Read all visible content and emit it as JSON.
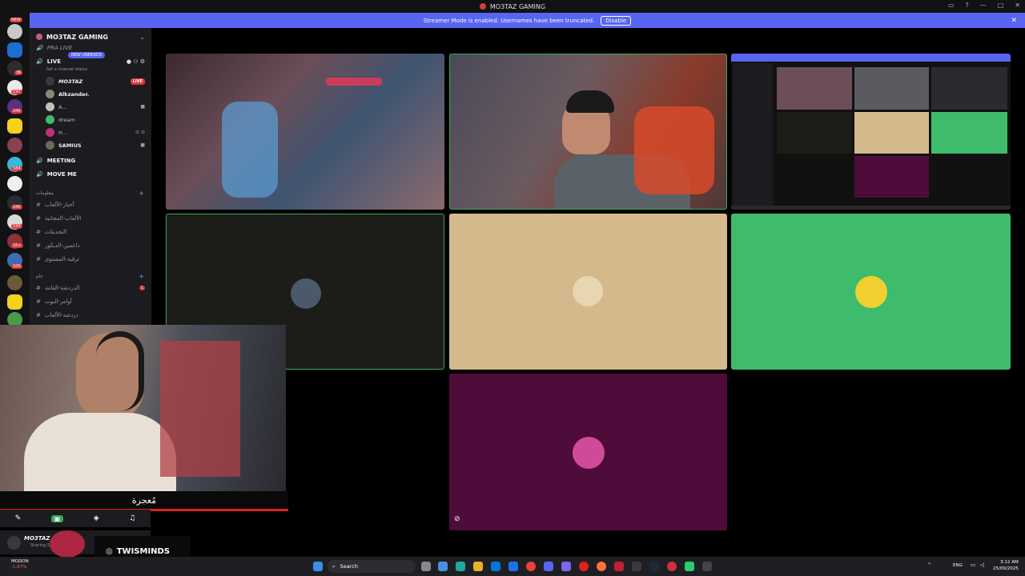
{
  "window": {
    "title": "MO3TAZ GAMING"
  },
  "banner": {
    "text": "Streamer Mode is enabled. Usernames have been truncated.",
    "button": "Disable"
  },
  "server_list": {
    "new_label": "NEW",
    "badges": [
      "36",
      "197",
      "240",
      "584",
      "240",
      "190",
      "1K+",
      "100"
    ]
  },
  "sidebar": {
    "server_name": "MO3TAZ GAMING",
    "pra_live": "PRA LIVE",
    "new_unreads": "NEW UNREADS",
    "live_channel": "LIVE",
    "status_placeholder": "Set a channel status",
    "voice_users": [
      {
        "name": "MO3TAZ",
        "live": "LIVE"
      },
      {
        "name": "Alkzander."
      },
      {
        "name": "A..."
      },
      {
        "name": "dream"
      },
      {
        "name": "H..."
      },
      {
        "name": "SAMIUS"
      }
    ],
    "channels": [
      "MEETING",
      "MOVE ME"
    ],
    "category_1": "معلومات",
    "category_1_channels": [
      "أخبار-الألعاب",
      "الألعاب-المجانية",
      "التحديثات",
      "داعمين-الديكور",
      "ترقية-المستوى"
    ],
    "category_2": "عام",
    "category_2_channels": [
      "الدردشة-العامة",
      "أوامر-البوت",
      "دردشة-الألعاب"
    ],
    "mention_count": "1"
  },
  "overlay": {
    "caption": "مُعجزة",
    "instagram_label": "TWISMINDS"
  },
  "user_panel": {
    "name": "MO3TAZ",
    "status": "Sharing S..."
  },
  "taskbar": {
    "stock_name": "MODON",
    "stock_change": "-1.67%",
    "search_placeholder": "Search",
    "language": "ENG",
    "time": "3:12 AM",
    "date": "25/09/2025"
  },
  "colors": {
    "accent": "#5865f2",
    "live_red": "#da373c",
    "speaking_green": "#3ba55d",
    "tile_dark": "#1c1c18",
    "tile_tan": "#d4b98c",
    "tile_green": "#3ebc6b",
    "tile_purple": "#4e0c3a"
  },
  "icons": [
    "discord-logo-icon",
    "monitor-icon",
    "help-icon",
    "minimize-icon",
    "maximize-icon",
    "close-icon",
    "chevron-down-icon",
    "speaker-icon",
    "camera-icon",
    "mute-icon",
    "hash-icon",
    "plus-icon",
    "mic-mute-icon",
    "screen-share-icon",
    "activity-icon",
    "soundboard-icon",
    "instagram-icon",
    "windows-start-icon",
    "search-icon"
  ]
}
